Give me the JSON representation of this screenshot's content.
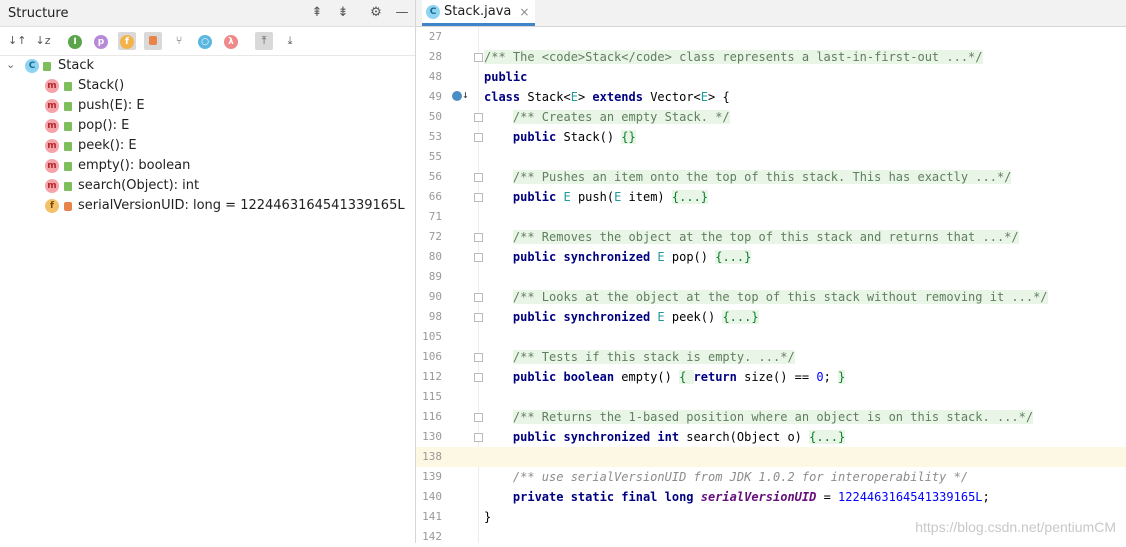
{
  "structure": {
    "title": "Structure",
    "tree": {
      "root": "Stack",
      "items": [
        {
          "label": "Stack()",
          "kind": "method"
        },
        {
          "label": "push(E): E",
          "kind": "method"
        },
        {
          "label": "pop(): E",
          "kind": "method"
        },
        {
          "label": "peek(): E",
          "kind": "method"
        },
        {
          "label": "empty(): boolean",
          "kind": "method"
        },
        {
          "label": "search(Object): int",
          "kind": "method"
        },
        {
          "label": "serialVersionUID: long = 1224463164541339165L",
          "kind": "field"
        }
      ]
    },
    "toolbar_icons": [
      "sort-visibility-icon",
      "sort-alpha-icon",
      "show-inherited-icon",
      "show-properties-icon",
      "show-fields-icon",
      "show-non-public-icon",
      "show-anonymous-icon",
      "show-lambdas-icon",
      "lambda-icon",
      "autoscroll-to-source-icon",
      "autoscroll-from-source-icon"
    ]
  },
  "editor": {
    "tab": {
      "label": "Stack.java",
      "close": "×"
    },
    "lines": [
      {
        "n": "27",
        "parts": []
      },
      {
        "n": "28",
        "parts": [
          {
            "t": "/** The <code>Stack</code> class represents a last-in-first-out ...*/",
            "c": "doc"
          }
        ]
      },
      {
        "n": "48",
        "parts": [
          {
            "t": "public",
            "c": "kw"
          }
        ]
      },
      {
        "n": "49",
        "parts": [
          {
            "t": "class ",
            "c": "kw"
          },
          {
            "t": "Stack<",
            "c": "plain"
          },
          {
            "t": "E",
            "c": "gen"
          },
          {
            "t": "> ",
            "c": "plain"
          },
          {
            "t": "extends ",
            "c": "kw"
          },
          {
            "t": "Vector<",
            "c": "plain"
          },
          {
            "t": "E",
            "c": "gen"
          },
          {
            "t": "> {",
            "c": "plain"
          }
        ]
      },
      {
        "n": "50",
        "parts": [
          {
            "t": "    ",
            "c": "plain"
          },
          {
            "t": "/** Creates an empty Stack. */",
            "c": "doc"
          }
        ]
      },
      {
        "n": "53",
        "parts": [
          {
            "t": "    ",
            "c": "plain"
          },
          {
            "t": "public ",
            "c": "kw"
          },
          {
            "t": "Stack() ",
            "c": "plain"
          },
          {
            "t": "{}",
            "c": "fc"
          }
        ]
      },
      {
        "n": "55",
        "parts": []
      },
      {
        "n": "56",
        "parts": [
          {
            "t": "    ",
            "c": "plain"
          },
          {
            "t": "/** Pushes an item onto the top of this stack. This has exactly ...*/",
            "c": "doc"
          }
        ]
      },
      {
        "n": "66",
        "parts": [
          {
            "t": "    ",
            "c": "plain"
          },
          {
            "t": "public ",
            "c": "kw"
          },
          {
            "t": "E",
            "c": "gen"
          },
          {
            "t": " push(",
            "c": "plain"
          },
          {
            "t": "E",
            "c": "gen"
          },
          {
            "t": " item) ",
            "c": "plain"
          },
          {
            "t": "{...}",
            "c": "fc"
          }
        ]
      },
      {
        "n": "71",
        "parts": []
      },
      {
        "n": "72",
        "parts": [
          {
            "t": "    ",
            "c": "plain"
          },
          {
            "t": "/** Removes the object at the top of this stack and returns that ...*/",
            "c": "doc"
          }
        ]
      },
      {
        "n": "80",
        "parts": [
          {
            "t": "    ",
            "c": "plain"
          },
          {
            "t": "public synchronized ",
            "c": "kw"
          },
          {
            "t": "E",
            "c": "gen"
          },
          {
            "t": " pop() ",
            "c": "plain"
          },
          {
            "t": "{...}",
            "c": "fc"
          }
        ]
      },
      {
        "n": "89",
        "parts": []
      },
      {
        "n": "90",
        "parts": [
          {
            "t": "    ",
            "c": "plain"
          },
          {
            "t": "/** Looks at the object at the top of this stack without removing it ...*/",
            "c": "doc"
          }
        ]
      },
      {
        "n": "98",
        "parts": [
          {
            "t": "    ",
            "c": "plain"
          },
          {
            "t": "public synchronized ",
            "c": "kw"
          },
          {
            "t": "E",
            "c": "gen"
          },
          {
            "t": " peek() ",
            "c": "plain"
          },
          {
            "t": "{...}",
            "c": "fc"
          }
        ]
      },
      {
        "n": "105",
        "parts": []
      },
      {
        "n": "106",
        "parts": [
          {
            "t": "    ",
            "c": "plain"
          },
          {
            "t": "/** Tests if this stack is empty. ...*/",
            "c": "doc"
          }
        ]
      },
      {
        "n": "112",
        "parts": [
          {
            "t": "    ",
            "c": "plain"
          },
          {
            "t": "public boolean ",
            "c": "kw"
          },
          {
            "t": "empty() ",
            "c": "plain"
          },
          {
            "t": "{ ",
            "c": "fc"
          },
          {
            "t": "return ",
            "c": "kw"
          },
          {
            "t": "size() == ",
            "c": "plain"
          },
          {
            "t": "0",
            "c": "num"
          },
          {
            "t": "; ",
            "c": "plain"
          },
          {
            "t": "}",
            "c": "fc"
          }
        ]
      },
      {
        "n": "115",
        "parts": []
      },
      {
        "n": "116",
        "parts": [
          {
            "t": "    ",
            "c": "plain"
          },
          {
            "t": "/** Returns the 1-based position where an object is on this stack. ...*/",
            "c": "doc"
          }
        ]
      },
      {
        "n": "130",
        "parts": [
          {
            "t": "    ",
            "c": "plain"
          },
          {
            "t": "public synchronized int ",
            "c": "kw"
          },
          {
            "t": "search(Object o) ",
            "c": "plain"
          },
          {
            "t": "{...}",
            "c": "fc"
          }
        ]
      },
      {
        "n": "138",
        "parts": [],
        "current": true
      },
      {
        "n": "139",
        "parts": [
          {
            "t": "    ",
            "c": "plain"
          },
          {
            "t": "/** use serialVersionUID from JDK 1.0.2 for interoperability */",
            "c": "cmt"
          }
        ]
      },
      {
        "n": "140",
        "parts": [
          {
            "t": "    ",
            "c": "plain"
          },
          {
            "t": "private static final long ",
            "c": "kw"
          },
          {
            "t": "serialVersionUID",
            "c": "fld"
          },
          {
            "t": " = ",
            "c": "plain"
          },
          {
            "t": "1224463164541339165L",
            "c": "num"
          },
          {
            "t": ";",
            "c": "plain"
          }
        ]
      },
      {
        "n": "141",
        "parts": [
          {
            "t": "}",
            "c": "plain"
          }
        ]
      },
      {
        "n": "142",
        "parts": []
      }
    ],
    "fold_lines": [
      "28",
      "50",
      "53",
      "56",
      "66",
      "72",
      "80",
      "90",
      "98",
      "106",
      "112",
      "116",
      "130"
    ],
    "override_line": "49"
  },
  "watermark": "https://blog.csdn.net/pentiumCM"
}
